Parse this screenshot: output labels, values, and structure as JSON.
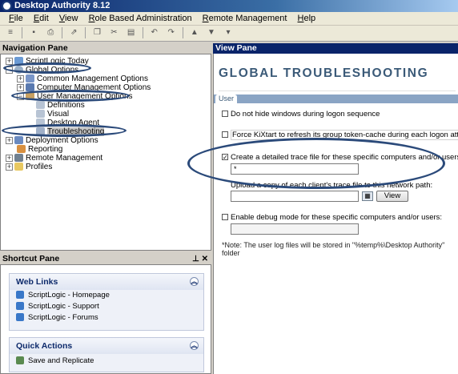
{
  "window": {
    "title": "Desktop Authority 8.12"
  },
  "menu": [
    "File",
    "Edit",
    "View",
    "Role Based Administration",
    "Remote Management",
    "Help"
  ],
  "navigation": {
    "header": "Navigation Pane",
    "items": [
      {
        "label": "ScriptLogic Today"
      },
      {
        "label": "Global Options"
      },
      {
        "label": "Common Management Options"
      },
      {
        "label": "Computer Management Options"
      },
      {
        "label": "User Management Options"
      },
      {
        "label": "Definitions"
      },
      {
        "label": "Visual"
      },
      {
        "label": "Desktop Agent"
      },
      {
        "label": "Troubleshooting"
      },
      {
        "label": "Deployment Options"
      },
      {
        "label": "Reporting"
      },
      {
        "label": "Remote Management"
      },
      {
        "label": "Profiles"
      }
    ]
  },
  "shortcut": {
    "header": "Shortcut Pane",
    "web_links": {
      "title": "Web Links",
      "links": [
        "ScriptLogic - Homepage",
        "ScriptLogic - Support",
        "ScriptLogic - Forums"
      ]
    },
    "quick_actions": {
      "title": "Quick Actions",
      "links": [
        "Save and Replicate"
      ]
    }
  },
  "view": {
    "header": "View Pane",
    "banner": "GLOBAL TROUBLESHOOTING",
    "tab": "User",
    "options": {
      "hide_windows": {
        "label": "Do not hide windows during logon sequence",
        "checked": false
      },
      "force_kixtart": {
        "label": "Force KiXtart to refresh its group token-cache during each logon attempt",
        "checked": false
      },
      "trace_file": {
        "label": "Create a detailed trace file for these specific computers and/or users:",
        "checked": true,
        "value": "*"
      },
      "upload_label": "Upload a copy of each client's trace file to this network path:",
      "upload_value": "",
      "view_button": "View",
      "debug_mode": {
        "label": "Enable debug mode for these specific computers and/or users:",
        "checked": false,
        "value": ""
      }
    },
    "note": "*Note: The user log files will be stored in \"%temp%\\Desktop Authority\" folder"
  }
}
